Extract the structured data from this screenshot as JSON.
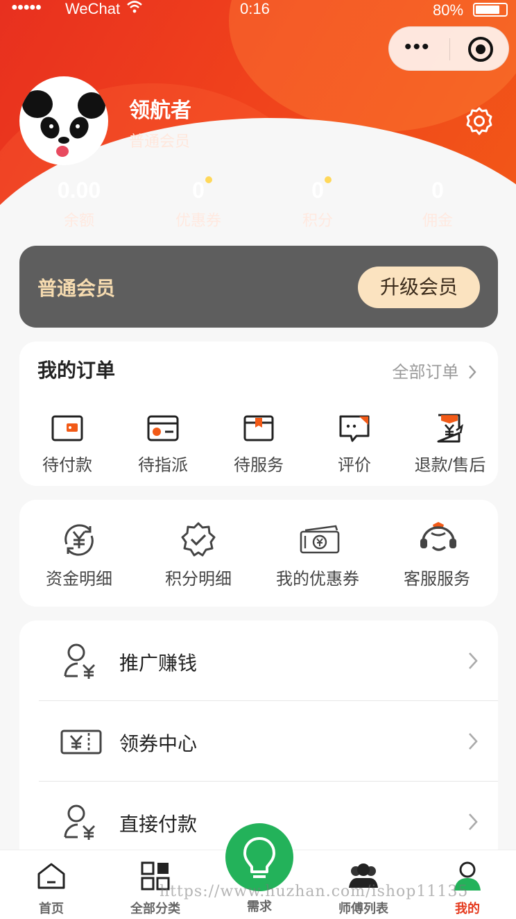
{
  "status_bar": {
    "signal": "●●●●●",
    "carrier": "WeChat",
    "time": "0:16",
    "battery": "80%",
    "battery_level": 0.8
  },
  "profile": {
    "name": "领航者",
    "level": "普通会员"
  },
  "stats": [
    {
      "value": "0.00",
      "label": "余额",
      "has_dot": false
    },
    {
      "value": "0",
      "label": "优惠券",
      "has_dot": true
    },
    {
      "value": "0",
      "label": "积分",
      "has_dot": true
    },
    {
      "value": "0",
      "label": "佣金",
      "has_dot": false
    }
  ],
  "membership": {
    "title": "普通会员",
    "upgrade_label": "升级会员"
  },
  "orders": {
    "title": "我的订单",
    "all_label": "全部订单",
    "items": [
      {
        "label": "待付款",
        "icon": "wallet-icon"
      },
      {
        "label": "待指派",
        "icon": "card-icon"
      },
      {
        "label": "待服务",
        "icon": "box-icon"
      },
      {
        "label": "评价",
        "icon": "comment-icon"
      },
      {
        "label": "退款/售后",
        "icon": "refund-icon"
      }
    ]
  },
  "tools": [
    {
      "label": "资金明细",
      "icon": "yuan-cycle-icon"
    },
    {
      "label": "积分明细",
      "icon": "badge-check-icon"
    },
    {
      "label": "我的优惠券",
      "icon": "ticket-icon"
    },
    {
      "label": "客服服务",
      "icon": "headset-icon"
    }
  ],
  "menu": [
    {
      "label": "推广赚钱",
      "icon": "user-yuan-icon"
    },
    {
      "label": "领券中心",
      "icon": "coupon-icon"
    },
    {
      "label": "直接付款",
      "icon": "user-yuan-icon"
    }
  ],
  "tabbar": {
    "items": [
      {
        "label": "首页",
        "icon": "home-icon",
        "active": false
      },
      {
        "label": "全部分类",
        "icon": "grid-icon",
        "active": false
      },
      {
        "label": "需求",
        "icon": "lightbulb-icon",
        "active": false
      },
      {
        "label": "师傅列表",
        "icon": "users-icon",
        "active": false
      },
      {
        "label": "我的",
        "icon": "profile-icon",
        "active": true
      }
    ]
  },
  "watermark": "https://www.huzhan.com/ishop11135",
  "colors": {
    "primary": "#e8301f",
    "member_bg": "#5e5e5e",
    "gold": "#fbe3c0",
    "accent_orange": "#f25a17",
    "center_green": "#23b25a"
  }
}
